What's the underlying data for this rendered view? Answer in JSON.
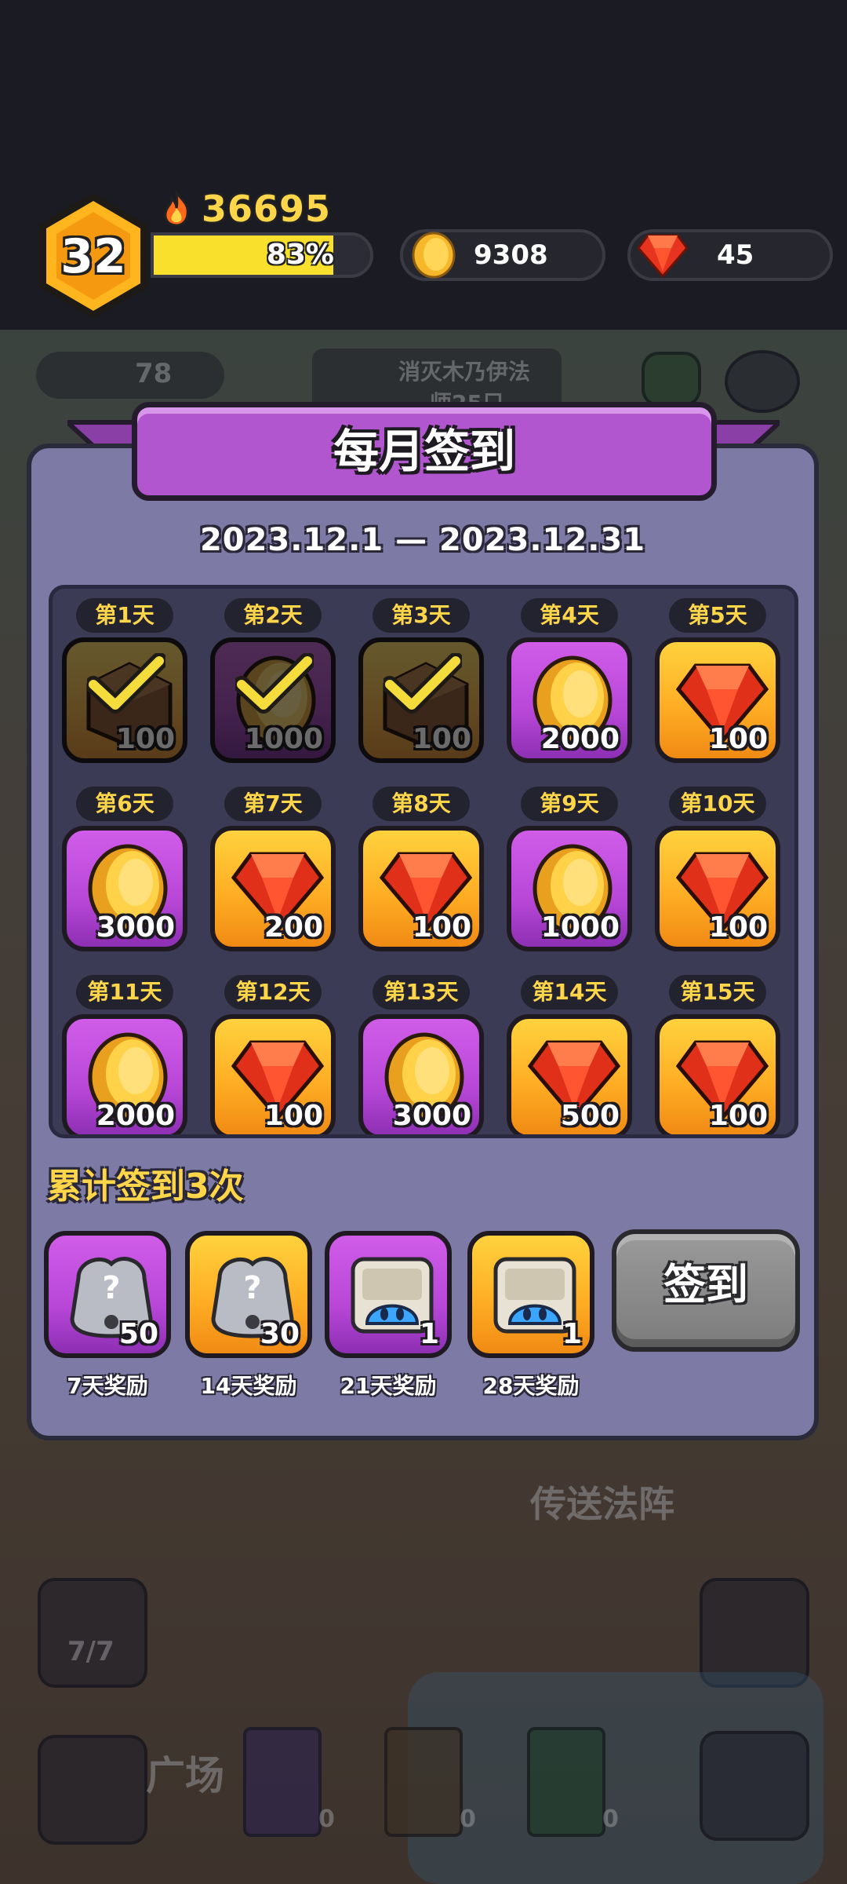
{
  "player": {
    "level": "32",
    "power": "36695",
    "xp_percent_label": "83%",
    "xp_fraction": 0.83,
    "coins": "9308",
    "gems": "45"
  },
  "background": {
    "meat_count": "78",
    "quest_text_line1": "消灭木乃伊法",
    "quest_text_line2": "师25只",
    "portal_label": "传送法阵",
    "plaza_label": "广场",
    "slime_count": "7/7",
    "book_counts": [
      "0",
      "0",
      "0"
    ]
  },
  "modal": {
    "title": "每月签到",
    "date_range": "2023.12.1  —  2023.12.31",
    "days": [
      {
        "label": "第1天",
        "reward": "chest",
        "amount": "100",
        "color": "orange",
        "claimed": true
      },
      {
        "label": "第2天",
        "reward": "coin",
        "amount": "1000",
        "color": "purple",
        "claimed": true
      },
      {
        "label": "第3天",
        "reward": "chest",
        "amount": "100",
        "color": "orange",
        "claimed": true
      },
      {
        "label": "第4天",
        "reward": "coin",
        "amount": "2000",
        "color": "purple",
        "claimed": false
      },
      {
        "label": "第5天",
        "reward": "gem",
        "amount": "100",
        "color": "orange",
        "claimed": false
      },
      {
        "label": "第6天",
        "reward": "coin",
        "amount": "3000",
        "color": "purple",
        "claimed": false
      },
      {
        "label": "第7天",
        "reward": "gem",
        "amount": "200",
        "color": "orange",
        "claimed": false
      },
      {
        "label": "第8天",
        "reward": "gem",
        "amount": "100",
        "color": "orange",
        "claimed": false
      },
      {
        "label": "第9天",
        "reward": "coin",
        "amount": "1000",
        "color": "purple",
        "claimed": false
      },
      {
        "label": "第10天",
        "reward": "gem",
        "amount": "100",
        "color": "orange",
        "claimed": false
      },
      {
        "label": "第11天",
        "reward": "coin",
        "amount": "2000",
        "color": "purple",
        "claimed": false
      },
      {
        "label": "第12天",
        "reward": "gem",
        "amount": "100",
        "color": "orange",
        "claimed": false
      },
      {
        "label": "第13天",
        "reward": "coin",
        "amount": "3000",
        "color": "purple",
        "claimed": false
      },
      {
        "label": "第14天",
        "reward": "gem",
        "amount": "500",
        "color": "orange",
        "claimed": false
      },
      {
        "label": "第15天",
        "reward": "gem",
        "amount": "100",
        "color": "orange",
        "claimed": false
      }
    ],
    "cumulative_text": "累计签到3次",
    "milestones": [
      {
        "label": "7天奖励",
        "reward": "mystery-stone",
        "amount": "50",
        "color": "purple"
      },
      {
        "label": "14天奖励",
        "reward": "mystery-stone",
        "amount": "30",
        "color": "orange"
      },
      {
        "label": "21天奖励",
        "reward": "slime-frame",
        "amount": "1",
        "color": "purple"
      },
      {
        "label": "28天奖励",
        "reward": "slime-frame",
        "amount": "1",
        "color": "orange"
      }
    ],
    "checkin_button": "签到"
  }
}
